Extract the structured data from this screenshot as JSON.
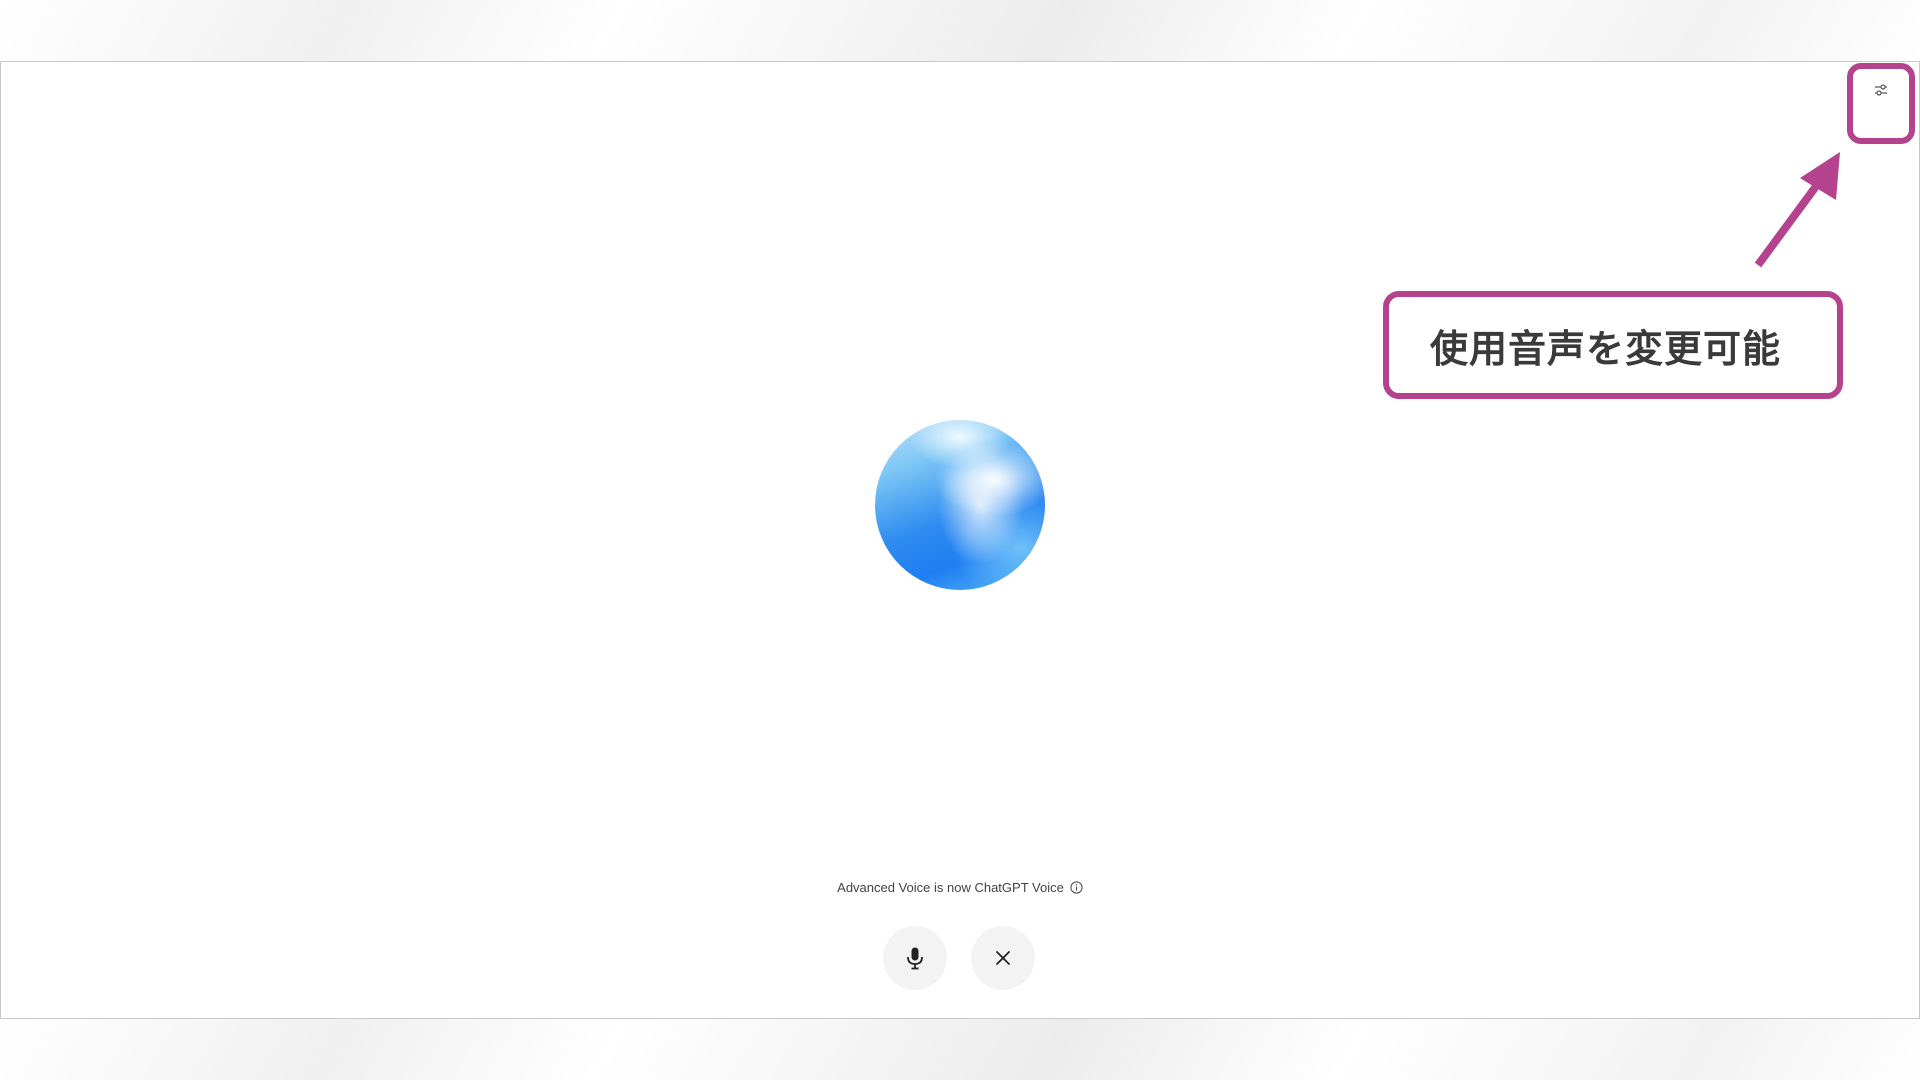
{
  "callout": {
    "text": "使用音声を変更可能"
  },
  "voice": {
    "notice_text": "Advanced Voice is now ChatGPT Voice"
  },
  "icons": {
    "settings": "sliders-icon",
    "info": "info-icon",
    "mic": "microphone-icon",
    "close": "close-icon"
  },
  "colors": {
    "annotation": "#b5428d",
    "button_bg": "#f3f3f3",
    "orb_primary": "#1f7ef2"
  }
}
